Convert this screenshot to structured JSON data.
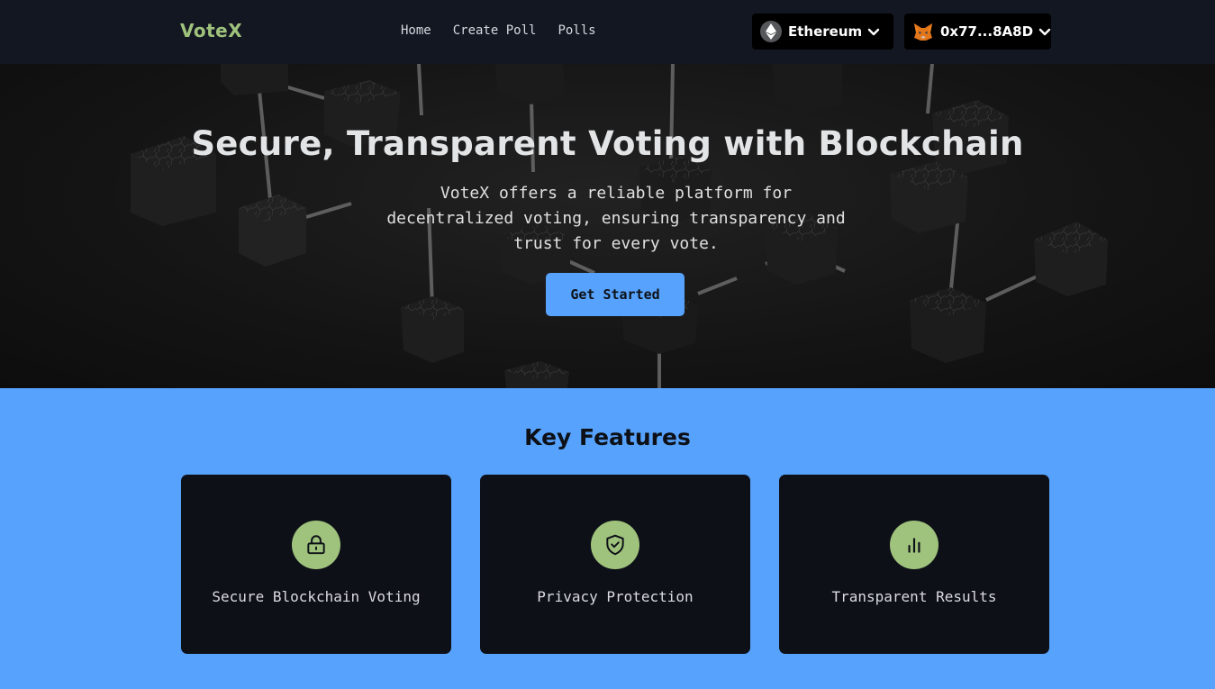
{
  "navbar": {
    "logo": "VoteX",
    "links": [
      "Home",
      "Create Poll",
      "Polls"
    ],
    "network": {
      "label": "Ethereum",
      "icon": "ethereum-icon"
    },
    "account": {
      "label": "0x77...8A8D",
      "icon": "metamask-fox-icon"
    }
  },
  "hero": {
    "title": "Secure, Transparent Voting with Blockchain",
    "subtitle": "VoteX offers a reliable platform for decentralized voting, ensuring transparency and trust for every vote.",
    "cta": "Get Started"
  },
  "features": {
    "title": "Key Features",
    "items": [
      {
        "label": "Secure Blockchain Voting",
        "icon": "lock-icon"
      },
      {
        "label": "Privacy Protection",
        "icon": "shield-check-icon"
      },
      {
        "label": "Transparent Results",
        "icon": "bar-chart-icon"
      }
    ]
  },
  "colors": {
    "navbar_bg": "#131722",
    "accent_blue": "#57a2fc",
    "accent_green": "#9fc27c",
    "card_bg": "#0d1017"
  }
}
